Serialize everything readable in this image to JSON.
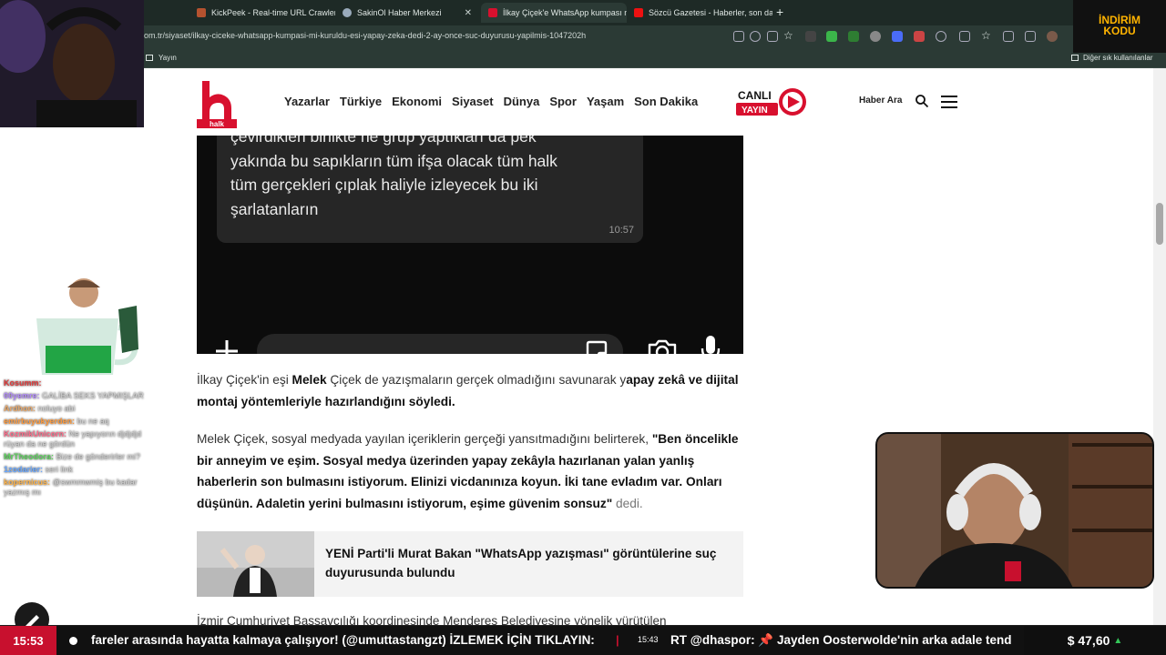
{
  "browser": {
    "tabs": [
      {
        "title": "KickPeek - Real-time URL Crawler",
        "active": false
      },
      {
        "title": "SakinOl Haber Merkezi",
        "active": false
      },
      {
        "title": "İlkay Çiçek'e WhatsApp kumpası m",
        "active": true
      },
      {
        "title": "Sözcü Gazetesi - Haberler, son dakik",
        "active": false
      }
    ],
    "url": "om.tr/siyaset/ilkay-ciceke-whatsapp-kumpasi-mi-kuruldu-esi-yapay-zeka-dedi-2-ay-once-suc-duyurusu-yapilmis-1047202h",
    "bookmark_left": "Yayın",
    "bookmark_right": "Diğer sık kullanılanlar"
  },
  "site": {
    "logo_text": "halk",
    "nav": [
      "Yazarlar",
      "Türkiye",
      "Ekonomi",
      "Siyaset",
      "Dünya",
      "Spor",
      "Yaşam",
      "Son Dakika"
    ],
    "live_label_1": "CANLI",
    "live_label_2": "YAYIN",
    "search_label": "Haber Ara"
  },
  "chat_image": {
    "message": "çevirdikleri birlikte ne grup yaptıkları da pek\nyakında bu sapıkların tüm ifşa olacak tüm halk\ntüm gerçekleri çıplak haliyle izleyecek bu iki\nşarlatanların",
    "time": "10:57"
  },
  "article": {
    "p1_a": "İlkay Çiçek'in eşi ",
    "p1_b": "Melek",
    "p1_c": " Çiçek de yazışmaların gerçek olmadığını savunarak y",
    "p1_d": "apay zekâ ve dijital montaj yöntemleriyle hazırlandığını söyledi.",
    "p2_a": "Melek Çiçek, sosyal medyada yayılan içeriklerin gerçeği yansıtmadığını belirterek, ",
    "p2_b": "\"Ben öncelikle bir anneyim ve eşim. Sosyal medya üzerinden yapay zekâyla hazırlanan yalan yanlış haberlerin son bulmasını istiyorum. Elinizi vicdanınıza koyun. İki tane evladım var. Onları düşünün. Adaletin yerini bulmasını istiyorum, eşime güvenim sonsuz\"",
    "p2_c": " dedi.",
    "related_title": "YENİ Parti'li Murat Bakan \"WhatsApp yazışması\" görüntülerine suç duyurusunda bulundu",
    "p3": "İzmir Cumhuriyet Başsavcılığı koordinesinde Menderes Belediyesine yönelik yürütülen"
  },
  "ticker": {
    "clock": "15:53",
    "text1": "fareler arasında hayatta kalmaya çalışıyor! (@umuttastangzt) İZLEMEK İÇİN TIKLAYIN:",
    "sep": "|",
    "time2": "15:43",
    "text2": "RT @dhaspor: 📌 Jayden Oosterwolde'nin arka adale tend",
    "price": "$ 47,60"
  },
  "stream": {
    "promo_1": "İNDİRİM",
    "promo_2": "KODU",
    "chat": [
      {
        "user": "Kosumm:",
        "msg": "",
        "color": "#e23b3b"
      },
      {
        "user": "00yemre:",
        "msg": "GALİBA SEKS YAPMIŞLAR",
        "color": "#b48cff"
      },
      {
        "user": "Ardhon:",
        "msg": "noluyo abi",
        "color": "#e8a86a"
      },
      {
        "user": "emirbuyukyerden:",
        "msg": "bu ne aq",
        "color": "#ff9a3c"
      },
      {
        "user": "KozmikUnicorn:",
        "msg": "Ne yapıyorın djdjdjd rüyan da ne gördün",
        "color": "#ff6b8a"
      },
      {
        "user": "MrTheodora:",
        "msg": "Bize de gönderirler mi?",
        "color": "#5fd35f"
      },
      {
        "user": "1zodarier:",
        "msg": "seri link",
        "color": "#6aa8ff"
      },
      {
        "user": "kopernicus:",
        "msg": "@swmmwmiş bu kadar yazmış mı",
        "color": "#ffb347"
      }
    ]
  }
}
